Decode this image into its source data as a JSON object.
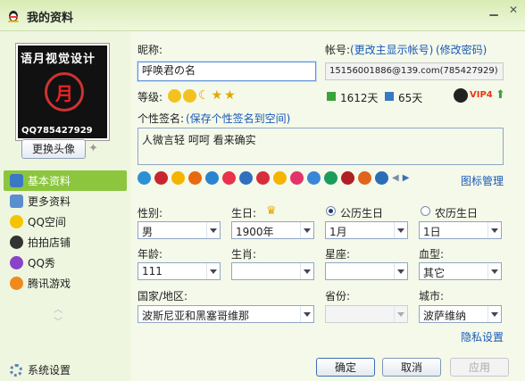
{
  "window": {
    "title": "我的资料",
    "app_icon": "qq-penguin-icon",
    "controls": [
      "minimize",
      "close"
    ]
  },
  "sidebar": {
    "avatar_text_top": "语月视觉设计",
    "avatar_text_bottom": "QQ785427929",
    "avatar_center_char": "月",
    "change_avatar_label": "更换头像",
    "items": [
      {
        "label": "基本资料",
        "icon": "profile-card-icon",
        "active": true
      },
      {
        "label": "更多资料",
        "icon": "more-info-icon",
        "active": false
      },
      {
        "label": "QQ空间",
        "icon": "qzone-star-icon",
        "active": false
      },
      {
        "label": "拍拍店铺",
        "icon": "paipai-shop-icon",
        "active": false
      },
      {
        "label": "QQ秀",
        "icon": "qqshow-icon",
        "active": false
      },
      {
        "label": "腾讯游戏",
        "icon": "tencent-games-icon",
        "active": false
      }
    ],
    "settings_label": "系统设置"
  },
  "profile": {
    "nickname_label": "昵称:",
    "nickname_value": "呼唤君の名",
    "account_label": "帐号:",
    "show_account_link": "(更改主显示帐号)",
    "change_password_link": "(修改密码)",
    "account_value": "15156001886@139.com(785427929)",
    "level_label": "等级:",
    "active_days": "1612天",
    "remaining_days": "65天",
    "vip_badge": "VIP4",
    "signature_label": "个性签名:",
    "save_signature_link": "(保存个性签名到空间)",
    "signature_value": "人微言轻 呵呵 看来确实",
    "icon_manage_link": "图标管理"
  },
  "fields": {
    "gender_label": "性别:",
    "gender_value": "男",
    "birthday_label": "生日:",
    "solar_label": "公历生日",
    "lunar_label": "农历生日",
    "year_value": "1900年",
    "month_value": "1月",
    "day_value": "1日",
    "age_label": "年龄:",
    "age_value": "111",
    "zodiac_label": "生肖:",
    "zodiac_value": "",
    "constellation_label": "星座:",
    "constellation_value": "",
    "blood_label": "血型:",
    "blood_value": "其它",
    "country_label": "国家/地区:",
    "country_value": "波斯尼亚和黑塞哥维那",
    "province_label": "省份:",
    "province_value": "",
    "city_label": "城市:",
    "city_value": "波萨维纳",
    "privacy_link": "隐私设置"
  },
  "buttons": {
    "ok": "确定",
    "cancel": "取消",
    "apply": "应用"
  },
  "colors": {
    "accent_green": "#8cc63f",
    "link_blue": "#1959b6",
    "title_bg": "#d9ecb4"
  }
}
